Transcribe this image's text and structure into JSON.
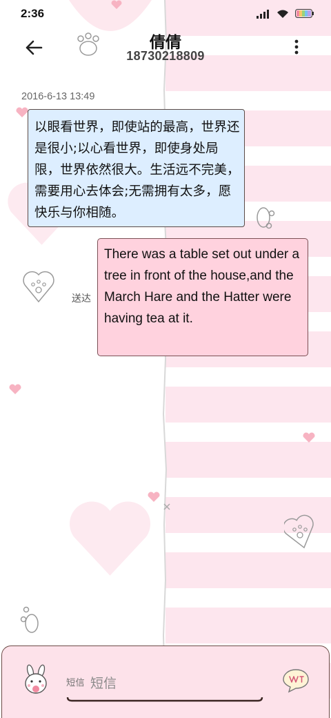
{
  "status_bar": {
    "time": "2:36",
    "icons": [
      "signal-icon",
      "wifi-icon",
      "battery-icon"
    ]
  },
  "header": {
    "back_icon": "arrow-left-icon",
    "contact_name": "倩倩",
    "phone_number": "18730218809",
    "more_icon": "more-vertical-icon"
  },
  "conversation": {
    "timestamp": "2016-6-13 13:49",
    "messages": [
      {
        "direction": "incoming",
        "text": "以眼看世界，即使站的最高，世界还是很小;以心看世界，即使身处局限，世界依然很大。生活远不完美，需要用心去体会;无需拥有太多，愿快乐与你相随。"
      },
      {
        "direction": "outgoing",
        "text": "There was a table set out under a tree in front of the house,and the March Hare and the Hatter were having tea at it.",
        "status": "送达"
      }
    ]
  },
  "composer": {
    "placeholder": "短信",
    "emoji_icon": "bunny-emoji-icon",
    "send_icon": "send-bubble-icon"
  },
  "colors": {
    "incoming_bubble": "#ddeeff",
    "outgoing_bubble": "#ffd2de",
    "stripe_pink": "#fde6ee",
    "heart_pink": "#f7b3c2"
  }
}
